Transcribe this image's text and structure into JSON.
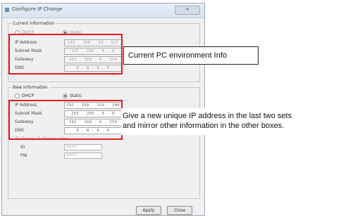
{
  "window": {
    "title": "Configure IP Change",
    "close_label": "✕"
  },
  "current_info": {
    "legend": "Current Information",
    "radio_dhcp": "DHCP",
    "radio_static": "Static",
    "fields": [
      {
        "label": "IP Address",
        "value": "192 . 168 . 10 . 127"
      },
      {
        "label": "Subnet Mask",
        "value": "255 . 255 . 0 . 0"
      },
      {
        "label": "Gateway",
        "value": "192 . 168 . 0 . 254"
      },
      {
        "label": "DNS",
        "value": "8 . 8 . 8 . 8"
      }
    ]
  },
  "new_info": {
    "legend": "New Information",
    "radio_dhcp": "DHCP",
    "radio_static": "Static",
    "fields": [
      {
        "label": "IP Address",
        "value": "192 . 168 . 150 . 100"
      },
      {
        "label": "Subnet Mask",
        "value": "255 . 255 . 0 . 0"
      },
      {
        "label": "Gateway",
        "value": "192 . 168 . 0 . 254"
      },
      {
        "label": "DNS",
        "value": "8 . 8 . 8 . 8"
      }
    ],
    "option_label": "IP Change Authentication",
    "extra_fields": [
      {
        "label": "ID",
        "placeholder": "admin"
      },
      {
        "label": "PW",
        "placeholder": "admin"
      }
    ]
  },
  "buttons": {
    "apply": "Apply",
    "close": "Close"
  },
  "annotations": {
    "current": "Current PC environment Info",
    "new_line1": "Give a new unique IP address in the last two sets",
    "new_line2": "and mirror other information in the other boxes."
  },
  "colors": {
    "highlight": "#e8191c"
  }
}
